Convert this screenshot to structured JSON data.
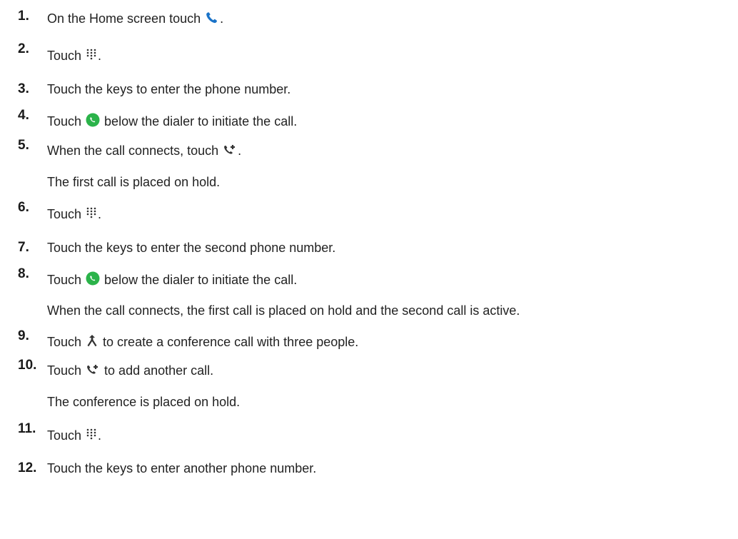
{
  "icons": {
    "phone": "phone-icon",
    "dialpad": "dialpad-icon",
    "call_button": "green-call-button-icon",
    "add_call": "add-call-icon",
    "merge": "merge-calls-icon",
    "phone_color": "#1a73c8",
    "call_button_color": "#2bb34a"
  },
  "steps": [
    {
      "num": "1.",
      "before": "On the Home screen touch ",
      "after": "."
    },
    {
      "num": "2.",
      "before": "Touch ",
      "after": "."
    },
    {
      "num": "3.",
      "text": "Touch the keys to enter the phone number."
    },
    {
      "num": "4.",
      "before": "Touch ",
      "after": " below the dialer to initiate the call."
    },
    {
      "num": "5.",
      "before": "When the call connects, touch ",
      "after": "."
    },
    {
      "note": "The first call is placed on hold."
    },
    {
      "num": "6.",
      "before": "Touch ",
      "after": "."
    },
    {
      "num": "7.",
      "text": "Touch the keys to enter the second phone number."
    },
    {
      "num": "8.",
      "before": "Touch ",
      "after": " below the dialer to initiate the call."
    },
    {
      "note": "When the call connects, the first call is placed on hold and the second call is active."
    },
    {
      "num": "9.",
      "before": "Touch ",
      "after": " to create a conference call with three people."
    },
    {
      "num": "10.",
      "before": "Touch ",
      "after": " to add another call."
    },
    {
      "note": "The conference is placed on hold."
    },
    {
      "num": "11.",
      "before": "Touch ",
      "after": "."
    },
    {
      "num": "12.",
      "text": "Touch the keys to enter another phone number."
    }
  ]
}
